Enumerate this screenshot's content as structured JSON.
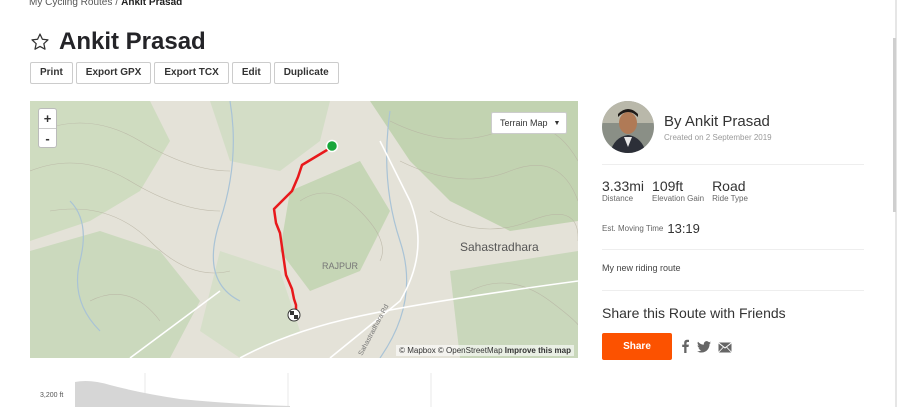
{
  "breadcrumb": {
    "parent": "My Cycling Routes",
    "separator": "/",
    "current": "Ankit Prasad"
  },
  "page_title": "Ankit Prasad",
  "actions": {
    "print": "Print",
    "export_gpx": "Export GPX",
    "export_tcx": "Export TCX",
    "edit": "Edit",
    "duplicate": "Duplicate"
  },
  "map": {
    "zoom_in": "+",
    "zoom_out": "-",
    "terrain_label": "Terrain Map",
    "place_labels": {
      "sahastradhara": "Sahastradhara",
      "rajpur": "RAJPUR",
      "road": "Sahastradhara Rd"
    },
    "attribution": {
      "mapbox": "© Mapbox",
      "osm": "© OpenStreetMap",
      "improve": "Improve this map"
    },
    "route_color": "#e8191c",
    "start_color": "#19a63b"
  },
  "author": {
    "name": "By Ankit Prasad",
    "created": "Created on 2 September 2019"
  },
  "stats": {
    "distance": {
      "value": "3.33mi",
      "label": "Distance"
    },
    "elevation": {
      "value": "109ft",
      "label": "Elevation Gain"
    },
    "ride_type": {
      "value": "Road",
      "label": "Ride Type"
    }
  },
  "moving_time": {
    "label": "Est. Moving Time",
    "value": "13:19"
  },
  "description": "My new riding route",
  "share": {
    "title": "Share this Route with Friends",
    "button": "Share"
  },
  "elevation_chart": {
    "y_label": "3,200 ft"
  },
  "colors": {
    "accent": "#fc5200"
  }
}
